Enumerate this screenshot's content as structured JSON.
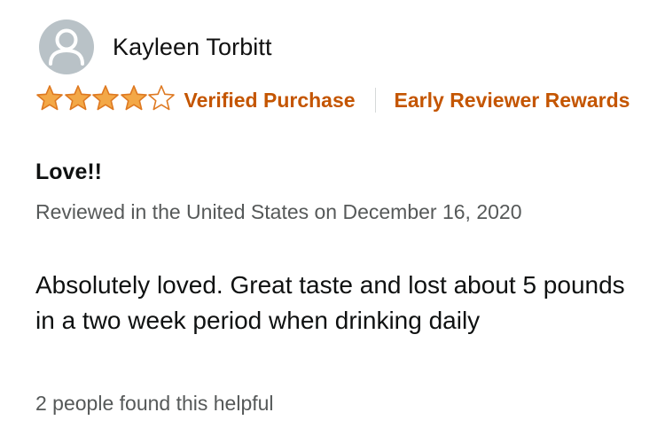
{
  "reviewer": {
    "name": "Kayleen Torbitt",
    "avatar_icon": "default-user-icon"
  },
  "rating": {
    "stars": 4,
    "max": 5,
    "star_color": "#f3a847",
    "star_outline": "#de7921"
  },
  "badges": {
    "verified": "Verified Purchase",
    "early_reviewer": "Early Reviewer Rewards"
  },
  "review": {
    "title": "Love!!",
    "date": "Reviewed in the United States on December 16, 2020",
    "body": "Absolutely loved. Great taste and lost about 5 pounds in a two week period when drinking daily",
    "helpful": "2 people found this helpful"
  },
  "colors": {
    "accent": "#c45500",
    "secondary_text": "#565959"
  }
}
